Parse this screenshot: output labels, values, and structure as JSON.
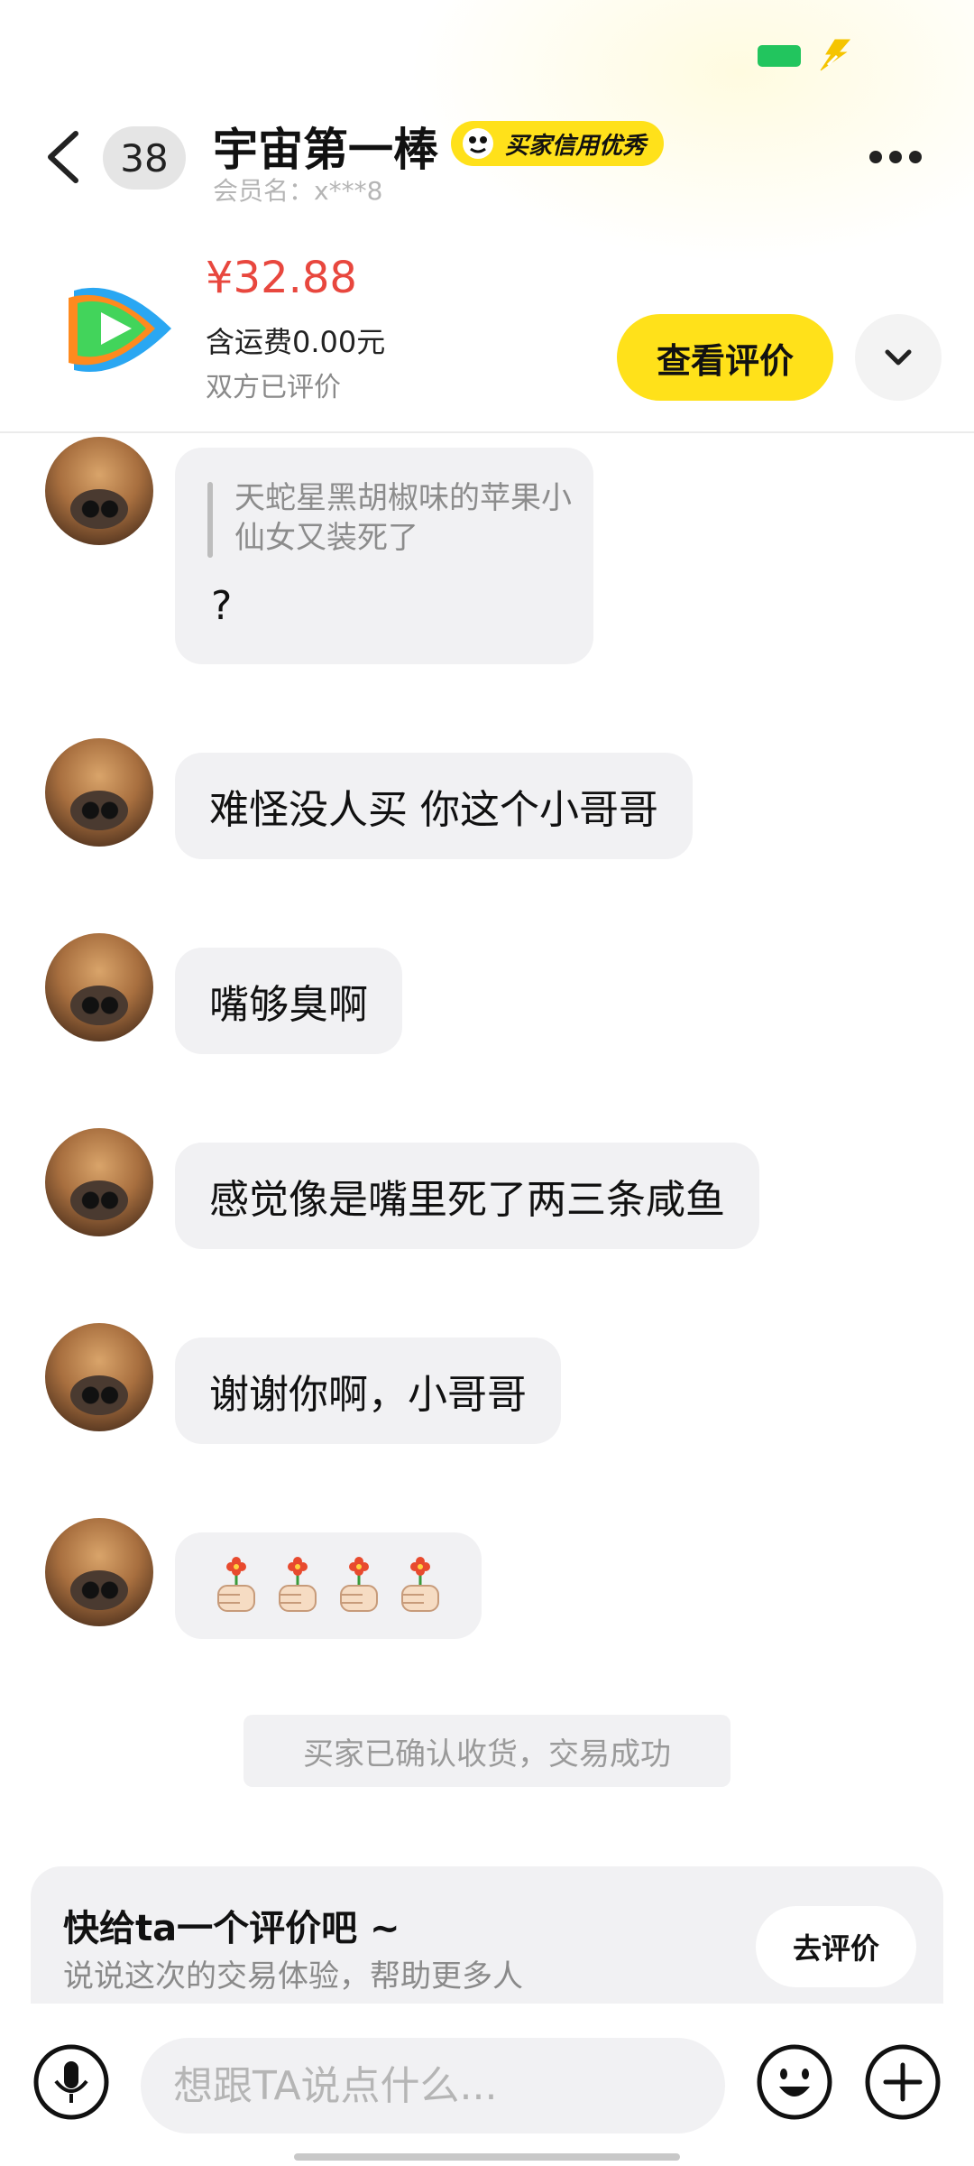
{
  "header": {
    "unread_count": "38",
    "seller_name": "宇宙第一棒",
    "credit_badge": "买家信用优秀",
    "member_name": "会员名：x***8"
  },
  "product": {
    "price": "¥32.88",
    "shipping": "含运费0.00元",
    "review_state": "双方已评价",
    "view_review_label": "查看评价"
  },
  "messages": [
    {
      "quote": "天蛇星黑胡椒味的苹果小仙女又装死了",
      "text": "?"
    },
    {
      "text": "难怪没人买  你这个小哥哥"
    },
    {
      "text": "嘴够臭啊"
    },
    {
      "text": "感觉像是嘴里死了两三条咸鱼"
    },
    {
      "text": "谢谢你啊，小哥哥"
    },
    {
      "emoji": "flower-thumb",
      "count": 4
    }
  ],
  "system_notice": "买家已确认收货，交易成功",
  "review_prompt": {
    "title": "快给ta一个评价吧 ~",
    "subtitle": "说说这次的交易体验，帮助更多人",
    "button": "去评价"
  },
  "input": {
    "placeholder": "想跟TA说点什么..."
  },
  "colors": {
    "accent_yellow": "#ffe11a",
    "price_red": "#e8473e",
    "bubble_gray": "#f1f1f3"
  },
  "icons": [
    "back-icon",
    "more-icon",
    "chevron-down-icon",
    "voice-icon",
    "emoji-icon",
    "plus-icon"
  ]
}
